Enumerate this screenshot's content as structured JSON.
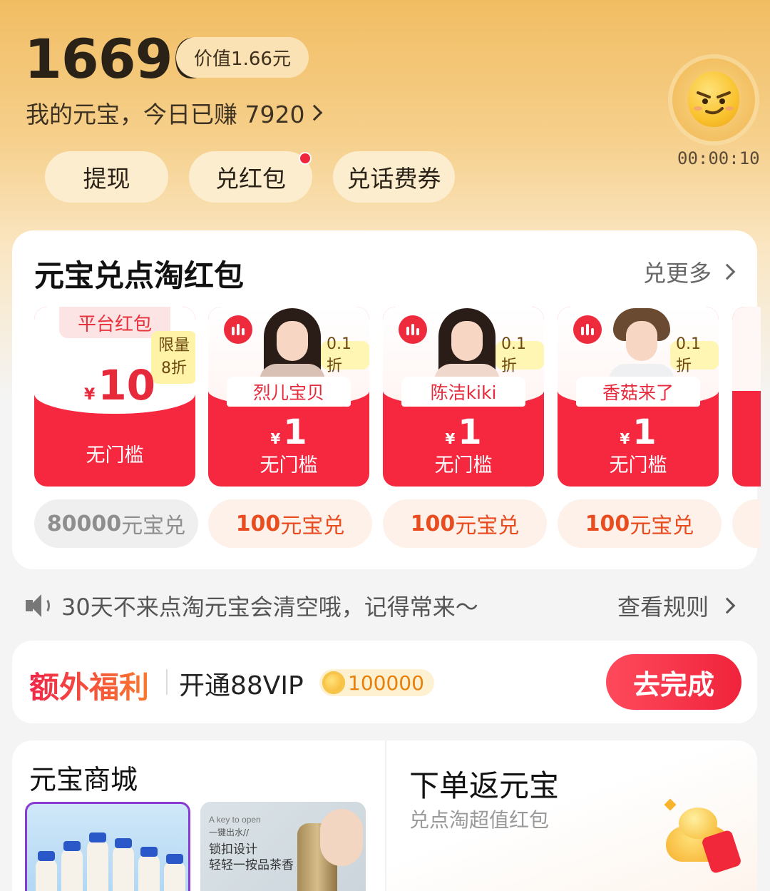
{
  "header": {
    "balance": "16696",
    "value_label": "价值1.66元",
    "earned_text": "我的元宝，今日已赚 7920",
    "actions": [
      {
        "label": "提现",
        "has_dot": false
      },
      {
        "label": "兑红包",
        "has_dot": true
      },
      {
        "label": "兑话费券",
        "has_dot": false
      }
    ],
    "timer": "00:00:10",
    "mascot_icon": "smirking-emoji-mascot"
  },
  "exchange": {
    "title": "元宝兑点淘红包",
    "more_label": "兑更多",
    "platform_packet": {
      "tag": "平台红包",
      "limit_line1": "限量",
      "limit_line2": "8折",
      "currency": "¥",
      "amount": "10",
      "threshold": "无门槛",
      "price_num": "80000",
      "price_unit": "元宝兑"
    },
    "streamer_packets": [
      {
        "name": "烈儿宝贝",
        "discount": "0.1折",
        "currency": "¥",
        "amount": "1",
        "threshold": "无门槛",
        "price_num": "100",
        "price_unit": "元宝兑"
      },
      {
        "name": "陈洁kiki",
        "discount": "0.1折",
        "currency": "¥",
        "amount": "1",
        "threshold": "无门槛",
        "price_num": "100",
        "price_unit": "元宝兑"
      },
      {
        "name": "香菇来了",
        "discount": "0.1折",
        "currency": "¥",
        "amount": "1",
        "threshold": "无门槛",
        "price_num": "100",
        "price_unit": "元宝兑"
      }
    ]
  },
  "notice": {
    "text": "30天不来点淘元宝会清空哦，记得常来～",
    "rules_label": "查看规则"
  },
  "bonus": {
    "title": "额外福利",
    "text": "开通88VIP",
    "coin_amount": "100000",
    "button_label": "去完成"
  },
  "mall": {
    "title": "元宝商城",
    "product2_line1": "A key to open",
    "product2_line2": "一键出水//",
    "product2_line3": "锁扣设计",
    "product2_line4": "轻轻一按品茶香"
  },
  "cashback": {
    "title": "下单返元宝",
    "subtitle": "兑点淘超值红包"
  },
  "colors": {
    "header_gold": "#f1bd63",
    "packet_red": "#f5283f",
    "accent_orange": "#e84c1f",
    "button_red": "#f0233b"
  }
}
